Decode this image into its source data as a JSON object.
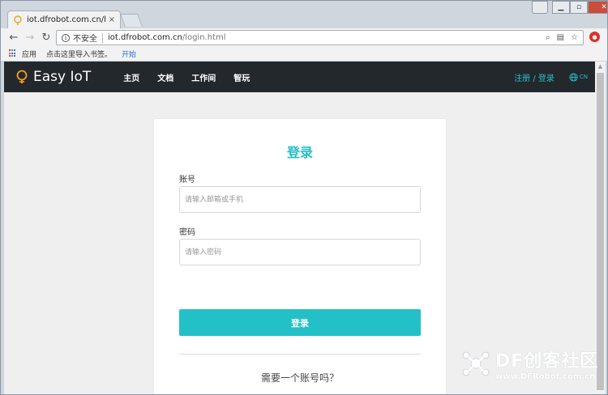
{
  "browser": {
    "tab_title": "iot.dfrobot.com.cn/logi",
    "tab_close": "×",
    "omnibox": {
      "security": "不安全",
      "host": "iot.dfrobot.com.cn",
      "path": "/login.html"
    },
    "bookmarks": [
      {
        "label": "应用"
      },
      {
        "label": "点击这里导入书签。"
      },
      {
        "label": "开始"
      }
    ]
  },
  "site": {
    "logo": "Easy IoT",
    "nav": [
      "主页",
      "文档",
      "工作间",
      "智玩"
    ],
    "auth": "注册 / 登录",
    "lang": "CN"
  },
  "login": {
    "title": "登录",
    "account_label": "账号",
    "account_placeholder": "请输入邮箱或手机",
    "password_label": "密码",
    "password_placeholder": "请输入密码",
    "submit_label": "登录",
    "need_account": "需要一个账号吗？"
  },
  "watermark": {
    "title": "DF创客社区",
    "url": "www.DFRobot.com.cn"
  },
  "colors": {
    "accent": "#23c0c7",
    "nav_bg": "#23282d"
  }
}
